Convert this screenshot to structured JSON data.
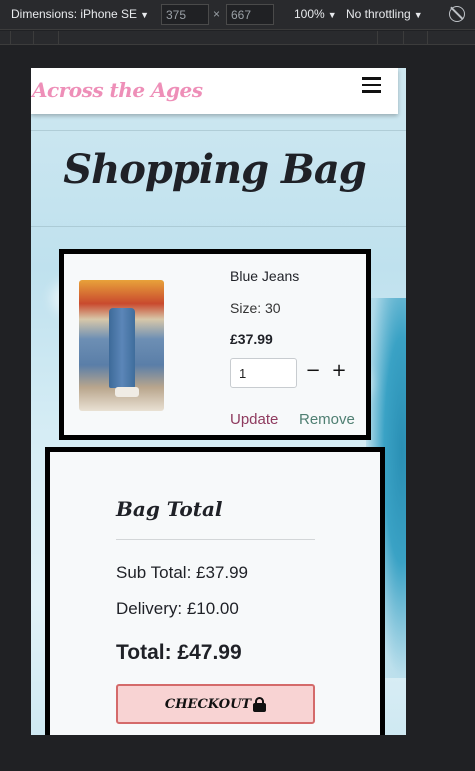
{
  "devtools": {
    "dimensions_label": "Dimensions: iPhone SE",
    "width": "375",
    "height": "667",
    "times": "×",
    "zoom": "100%",
    "throttling": "No throttling",
    "icons": [
      "caret-down-icon",
      "no-throttle-icon"
    ]
  },
  "navbar": {
    "brand": "Across the Ages",
    "menu_icon": "hamburger-menu-icon"
  },
  "page": {
    "title": "Shopping Bag"
  },
  "bag_item": {
    "name": "Blue Jeans",
    "size": "Size: 30",
    "price": "£37.99",
    "quantity": "1",
    "minus": "−",
    "plus": "+",
    "update_label": "Update",
    "remove_label": "Remove"
  },
  "bag_total": {
    "heading": "Bag Total",
    "subtotal": "Sub Total: £37.99",
    "delivery": "Delivery: £10.00",
    "total": "Total: £47.99",
    "checkout_label": "CHECKOUT",
    "checkout_icon": "lock-icon"
  },
  "colors": {
    "brand_pink": "#ee8fb8",
    "update_link": "#8e3a5e",
    "remove_link": "#4f7f72",
    "checkout_bg": "#f8d3d3",
    "checkout_border": "#d46a6a"
  }
}
